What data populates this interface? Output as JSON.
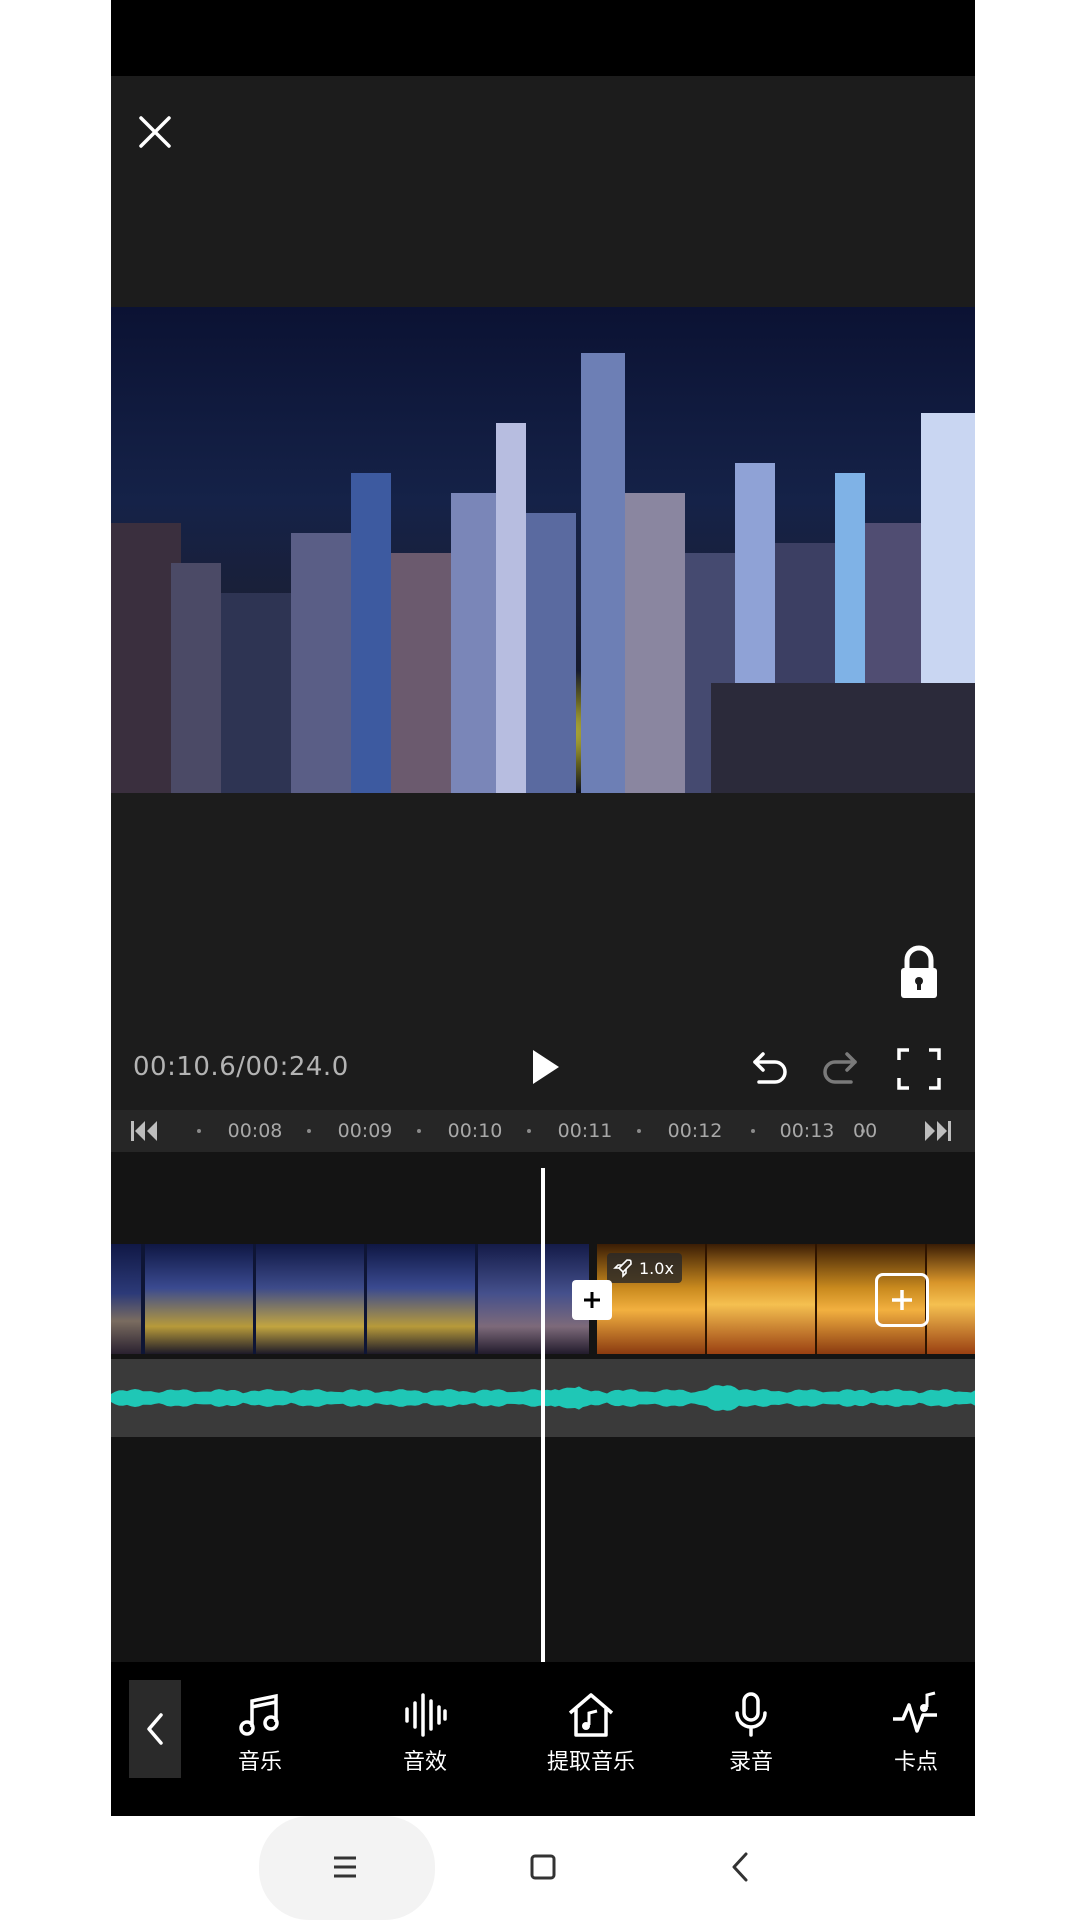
{
  "window": {
    "close_icon": "close-icon",
    "lock_icon": "lock-icon"
  },
  "playback": {
    "current_time": "00:10.6",
    "separator": "/",
    "total_time": "00:24.0",
    "play_icon": "play-icon",
    "undo_icon": "undo-icon",
    "redo_icon": "redo-icon",
    "fullscreen_icon": "fullscreen-icon"
  },
  "ruler": {
    "ticks": [
      "00:08",
      "00:09",
      "00:10",
      "00:11",
      "00:12",
      "00:13",
      "00"
    ],
    "skip_start_icon": "skip-to-start-icon",
    "skip_end_icon": "skip-to-end-icon"
  },
  "timeline": {
    "clip_2_speed": "1.0x",
    "speed_icon": "rocket-icon",
    "add_transition_icon": "plus-icon",
    "add_clip_icon": "plus-icon",
    "waveform_color": "#1fc7b6"
  },
  "toolbar": {
    "collapse_icon": "chevron-left-icon",
    "items": [
      {
        "label": "音乐",
        "icon": "music-note-icon"
      },
      {
        "label": "音效",
        "icon": "sound-wave-icon"
      },
      {
        "label": "提取音乐",
        "icon": "extract-music-icon"
      },
      {
        "label": "录音",
        "icon": "microphone-icon"
      },
      {
        "label": "卡点",
        "icon": "beat-icon"
      }
    ]
  },
  "nav": {
    "menu_icon": "menu-icon",
    "home_icon": "square-home-icon",
    "back_icon": "back-chevron-icon"
  }
}
